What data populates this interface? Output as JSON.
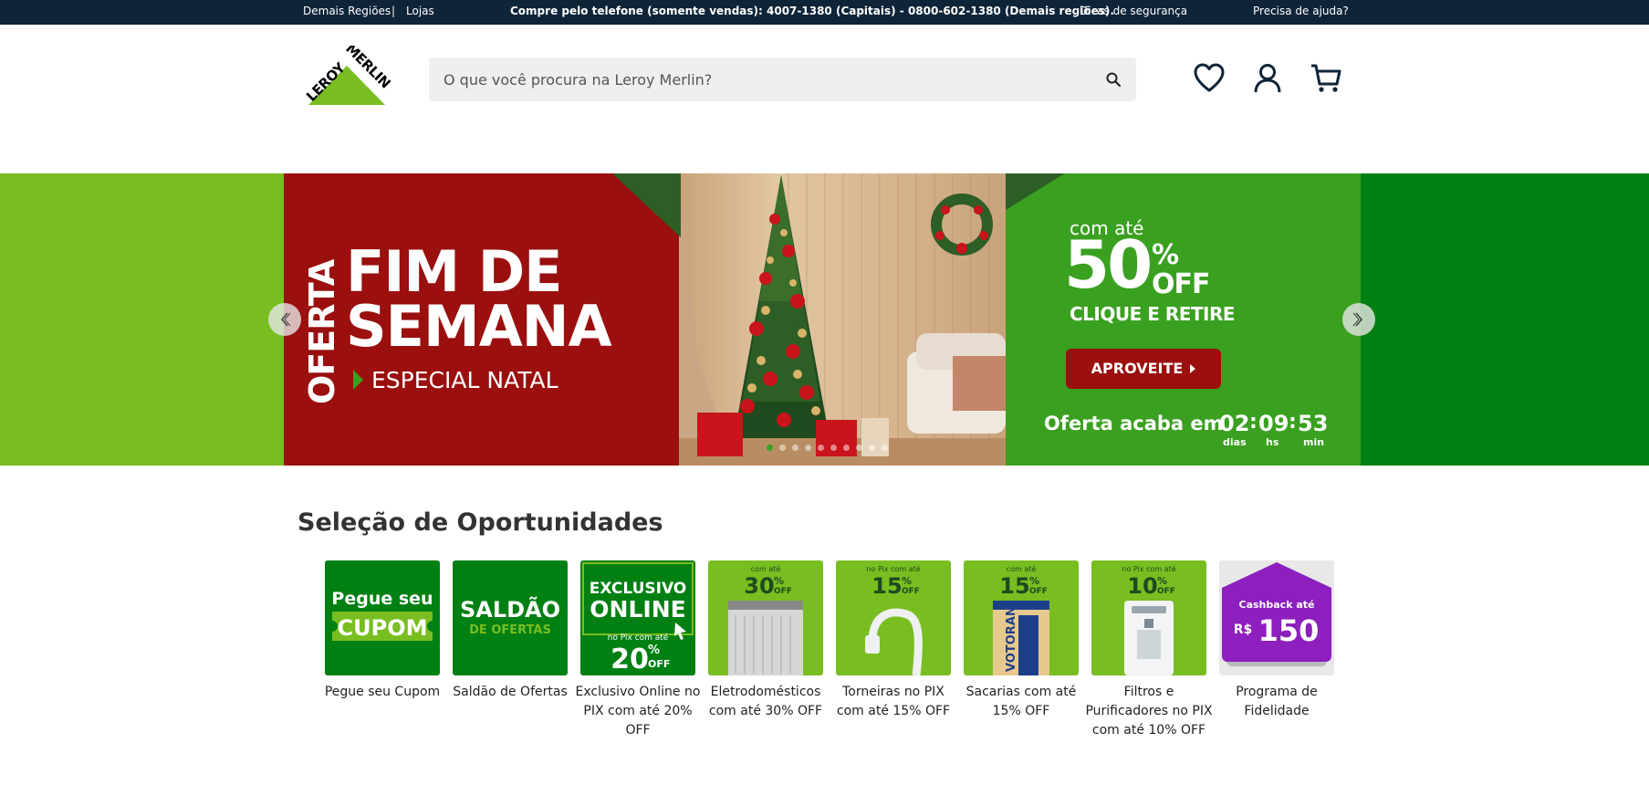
{
  "topbar": {
    "regions": "Demais Regiões",
    "separator": "|",
    "stores": "Lojas",
    "phone": "Compre pelo telefone (somente vendas): 4007-1380 (Capitais) - 0800-602-1380 (Demais regiões).",
    "security": "Dicas de segurança",
    "help": "Precisa de ajuda?"
  },
  "header": {
    "logo_text": "LEROY MERLIN",
    "search_placeholder": "O que você procura na Leroy Merlin?",
    "icons": [
      "heart-icon",
      "user-icon",
      "cart-icon"
    ]
  },
  "banner": {
    "oferta": "OFERTA",
    "headline_1": "FIM DE",
    "headline_2": "SEMANA",
    "subline": "ESPECIAL NATAL",
    "com_ate": "com até",
    "discount": "50",
    "pct": "%",
    "off": "OFF",
    "clique": "CLIQUE E RETIRE",
    "cta": "APROVEITE",
    "countdown_label": "Oferta acaba em",
    "days": "02",
    "hours": "09",
    "minutes": "53",
    "days_label": "dias",
    "hours_label": "hs",
    "minutes_label": "min",
    "colors": {
      "red": "#9b0f0f",
      "green": "#3aa020",
      "left_bg": "#78be20",
      "right_bg": "#008013"
    }
  },
  "section": {
    "title": "Seleção de Oportunidades",
    "cards": [
      {
        "caption": "Pegue seu Cupom",
        "l1": "Pegue seu",
        "l2": "CUPOM"
      },
      {
        "caption": "Saldão de Ofertas",
        "l1": "SALDÃO",
        "l2": "DE OFERTAS"
      },
      {
        "caption": "Exclusivo Online no PIX com até 20% OFF",
        "l1": "EXCLUSIVO",
        "l2": "ONLINE",
        "l3": "no Pix com até",
        "l4": "20",
        "l5": "%",
        "l6": "OFF"
      },
      {
        "caption": "Eletrodomésticos com até 30% OFF",
        "l1": "com até",
        "l2": "30",
        "l3": "%",
        "l4": "OFF"
      },
      {
        "caption": "Torneiras no PIX com até 15% OFF",
        "l1": "no Pix com até",
        "l2": "15",
        "l3": "%",
        "l4": "OFF"
      },
      {
        "caption": "Sacarias com até 15% OFF",
        "l1": "com até",
        "l2": "15",
        "l3": "%",
        "l4": "OFF",
        "l5": "VOTORAN"
      },
      {
        "caption": "Filtros e Purificadores no PIX com até 10% OFF",
        "l1": "no Pix com até",
        "l2": "10",
        "l3": "%",
        "l4": "OFF"
      },
      {
        "caption": "Programa de Fidelidade",
        "l1": "Cashback até",
        "l2": "R$",
        "l3": "150"
      }
    ]
  }
}
